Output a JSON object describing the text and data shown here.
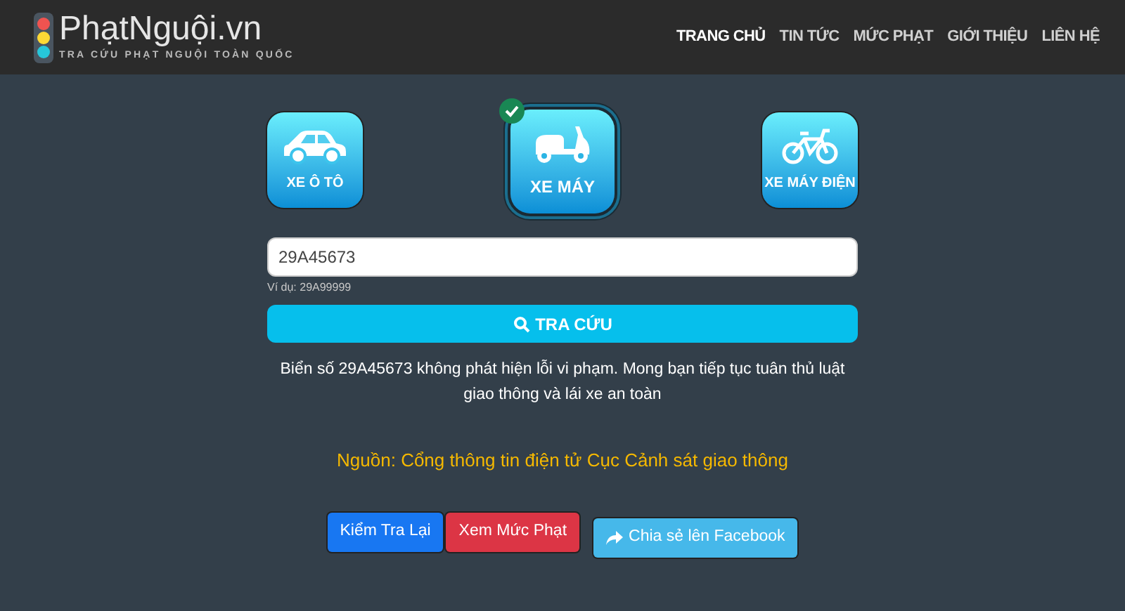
{
  "logo": {
    "title": "PhạtNguội.vn",
    "tagline": "TRA CỨU PHẠT NGUỘI TOÀN QUỐC"
  },
  "nav": [
    {
      "label": "TRANG CHỦ",
      "selected": true
    },
    {
      "label": "TIN TỨC",
      "selected": false
    },
    {
      "label": "MỨC PHẠT",
      "selected": false
    },
    {
      "label": "GIỚI THIỆU",
      "selected": false
    },
    {
      "label": "LIÊN HỆ",
      "selected": false
    }
  ],
  "vehicles": [
    {
      "kind": "car",
      "label": "XE Ô TÔ",
      "selected": false
    },
    {
      "kind": "scooter",
      "label": "XE MÁY",
      "selected": true
    },
    {
      "kind": "ebike",
      "label": "XE MÁY ĐIỆN",
      "selected": false
    }
  ],
  "plate_field": {
    "value": "29A45673",
    "hint": "Ví dụ: 29A99999"
  },
  "search_button": "TRA CỨU",
  "result": "Biển số 29A45673 không phát hiện lỗi vi phạm. Mong bạn tiếp tục tuân thủ luật giao thông và lái xe an toàn",
  "source": "Nguồn: Cổng thông tin điện tử Cục Cảnh sát giao thông",
  "actions": [
    {
      "kind": "recheck",
      "label": "Kiểm Tra Lại"
    },
    {
      "kind": "fines",
      "label": "Xem Mức Phạt"
    },
    {
      "kind": "share",
      "label": "Chia sẻ lên Facebook"
    }
  ]
}
